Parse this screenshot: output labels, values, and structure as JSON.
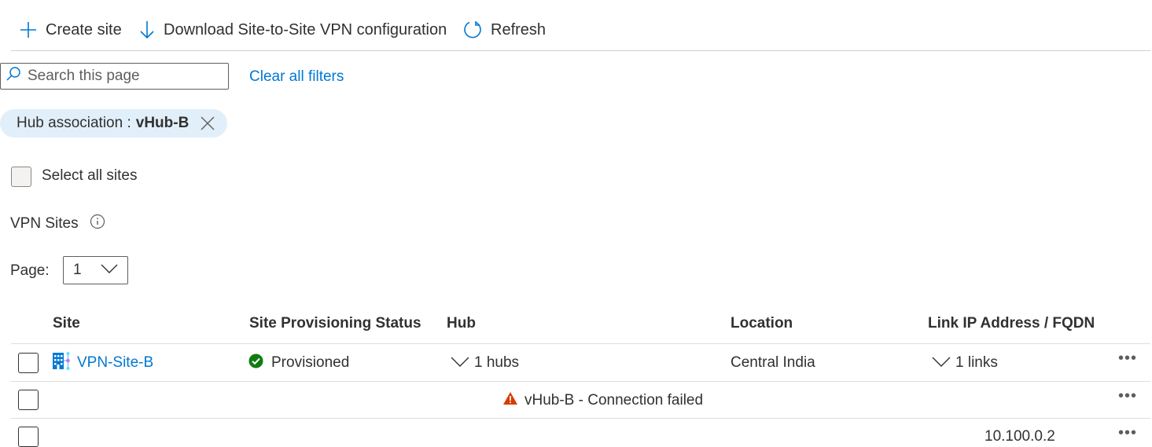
{
  "toolbar": {
    "create_label": "Create site",
    "download_label": "Download Site-to-Site VPN configuration",
    "refresh_label": "Refresh"
  },
  "search": {
    "placeholder": "Search this page",
    "value": ""
  },
  "clear_filters_label": "Clear all filters",
  "filter_pill": {
    "label": "Hub association : ",
    "value": "vHub-B"
  },
  "select_all_label": "Select all sites",
  "section_title": "VPN Sites",
  "pagination": {
    "label": "Page:",
    "selected": "1"
  },
  "table": {
    "headers": [
      "Site",
      "Site Provisioning Status",
      "Hub",
      "Location",
      "Link IP Address / FQDN"
    ],
    "rows": [
      {
        "site": "VPN-Site-B",
        "status": "Provisioned",
        "hub": "1 hubs",
        "location": "Central India",
        "links": "1 links"
      },
      {
        "hub_detail": "vHub-B - Connection failed"
      },
      {
        "link_ip": "10.100.0.2"
      }
    ]
  },
  "colors": {
    "accent": "#0078d4",
    "success": "#107c10",
    "warning": "#d83b01",
    "pill_bg": "#e1effa"
  }
}
